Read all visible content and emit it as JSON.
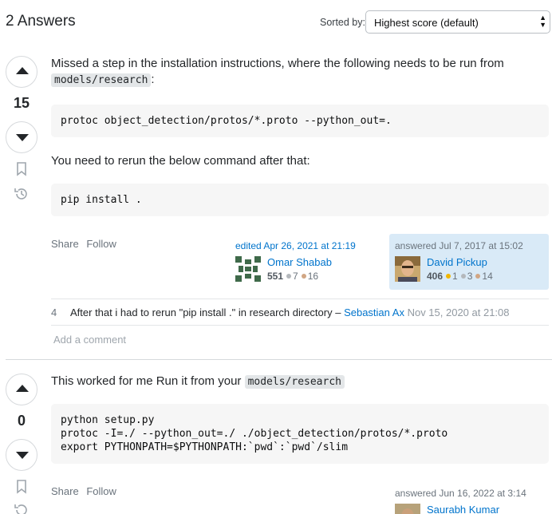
{
  "header": {
    "answers_count": "2 Answers",
    "sort_label": "Sorted by:",
    "sort_value": "Highest score (default)"
  },
  "answers": [
    {
      "score": "15",
      "intro_before": "Missed a step in the installation instructions, where the following needs to be run from ",
      "intro_code": "models/research",
      "intro_after": ":",
      "code1": "protoc object_detection/protos/*.proto --python_out=.",
      "text2": "You need to rerun the below command after that:",
      "code2": "pip install .",
      "share": "Share",
      "follow": "Follow",
      "edited": {
        "action": "edited Apr 26, 2021 at 21:19",
        "user": "Omar Shabab",
        "rep": "551",
        "silver": "7",
        "bronze": "16"
      },
      "owner": {
        "action": "answered Jul 7, 2017 at 15:02",
        "user": "David Pickup",
        "rep": "406",
        "gold": "1",
        "silver": "3",
        "bronze": "14"
      },
      "comments": [
        {
          "score": "4",
          "text": "After that i had to rerun \"pip install .\" in research directory – ",
          "user": "Sebastian Ax",
          "date": "Nov 15, 2020 at 21:08"
        }
      ],
      "add_comment": "Add a comment"
    },
    {
      "score": "0",
      "intro_before": "This worked for me Run it from your ",
      "intro_code": "models/research",
      "code": "python setup.py\nprotoc -I=./ --python_out=./ ./object_detection/protos/*.proto\nexport PYTHONPATH=$PYTHONPATH:`pwd`:`pwd`/slim",
      "share": "Share",
      "follow": "Follow",
      "owner": {
        "action": "answered Jun 16, 2022 at 3:14",
        "user": "Saurabh Kumar"
      }
    }
  ],
  "icons": [
    "vote-up-icon",
    "vote-down-icon",
    "bookmark-icon",
    "history-icon",
    "chevron-updown-icon"
  ],
  "colors": {
    "link": "#0074cc",
    "owner_bg": "#d9eaf7",
    "code_bg": "#f6f6f6"
  }
}
